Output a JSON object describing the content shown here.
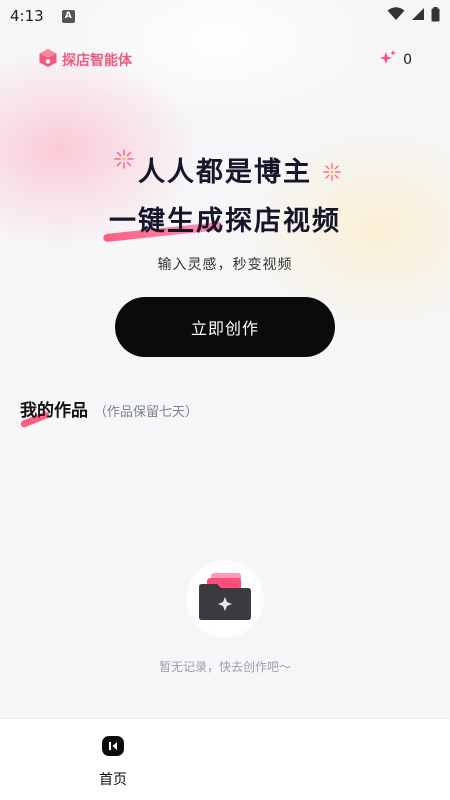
{
  "status_bar": {
    "time": "4:13",
    "notification_badge": "A"
  },
  "header": {
    "app_name": "探店智能体",
    "credits": "0",
    "brand_color": "#f05a80"
  },
  "hero": {
    "line1": "人人都是博主",
    "line2": "一键生成探店视频",
    "subtitle": "输入灵感，秒变视频"
  },
  "actions": {
    "create_label": "立即创作"
  },
  "works": {
    "title": "我的作品",
    "note": "（作品保留七天）",
    "empty_text": "暂无记录，快去创作吧～"
  },
  "tabbar": {
    "home_label": "首页"
  },
  "colors": {
    "accent_pink": "#ff5c86",
    "button_dark": "#0b0b0d"
  }
}
